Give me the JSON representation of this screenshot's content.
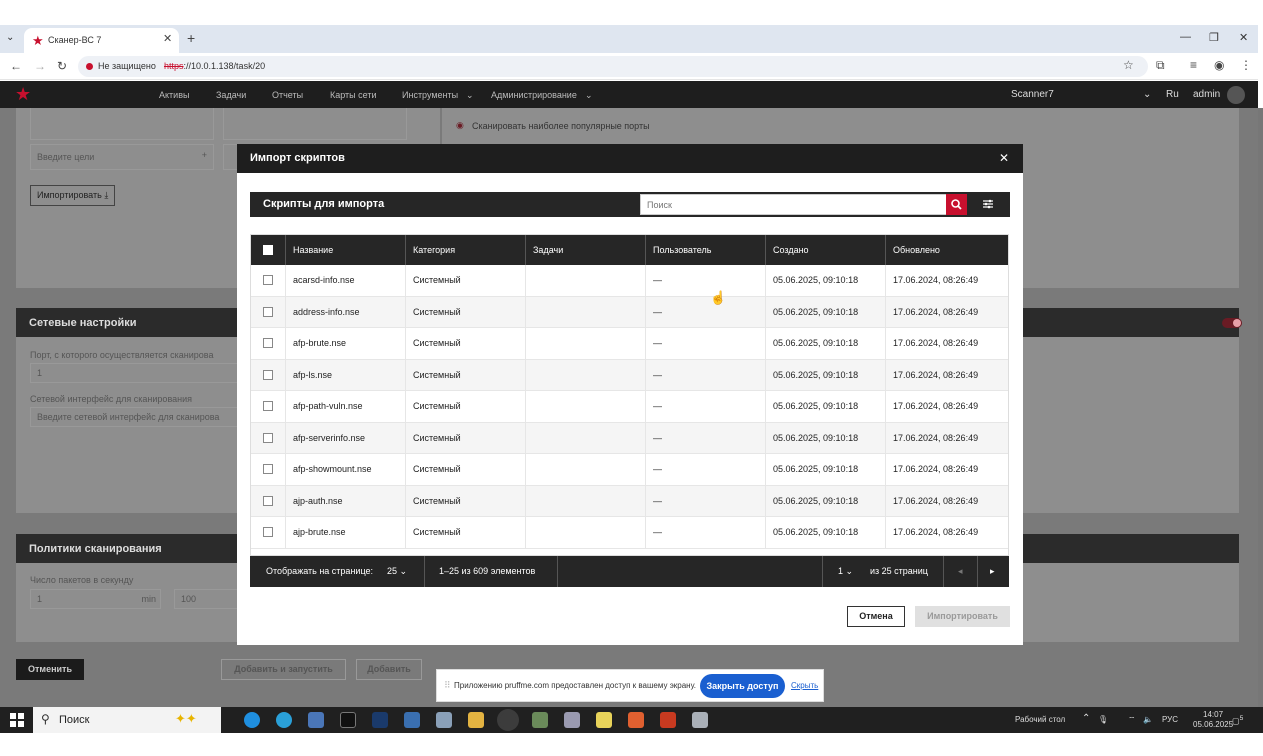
{
  "browser": {
    "tab_title": "Сканер-ВС 7",
    "security_label": "Не защищено",
    "url_scheme": "https",
    "url_rest": "://10.0.1.138/task/20"
  },
  "appnav": {
    "items": [
      "Активы",
      "Задачи",
      "Отчеты",
      "Карты сети",
      "Инструменты",
      "Администрирование"
    ],
    "scanner": "Scanner7",
    "lang": "Ru",
    "user": "admin"
  },
  "background": {
    "targets_placeholder": "Введите цели",
    "import_button": "Импортировать",
    "popular_ports": "Сканировать наиболее популярные порты",
    "net_settings_title": "Сетевые настройки",
    "port_label": "Порт, с которого осуществляется сканирова",
    "port_value": "1",
    "iface_label": "Сетевой интерфейс для сканирования",
    "iface_placeholder": "Введите сетевой интерфейс для сканирова",
    "policies_title": "Политики сканирования",
    "packets_label": "Число пакетов в секунду",
    "packets_min_value": "1",
    "packets_min_unit": "min",
    "packets_max_value": "100",
    "cancel_button": "Отменить",
    "add_run_button": "Добавить и запустить",
    "add_button": "Добавить"
  },
  "modal": {
    "title": "Импорт скриптов",
    "toolbar_title": "Скрипты для импорта",
    "search_placeholder": "Поиск",
    "columns": [
      "Название",
      "Категория",
      "Задачи",
      "Пользователь",
      "Создано",
      "Обновлено"
    ],
    "rows": [
      {
        "name": "acarsd-info.nse",
        "category": "Системный",
        "tasks": "",
        "user": "—",
        "created": "05.06.2025, 09:10:18",
        "updated": "17.06.2024, 08:26:49"
      },
      {
        "name": "address-info.nse",
        "category": "Системный",
        "tasks": "",
        "user": "—",
        "created": "05.06.2025, 09:10:18",
        "updated": "17.06.2024, 08:26:49"
      },
      {
        "name": "afp-brute.nse",
        "category": "Системный",
        "tasks": "",
        "user": "—",
        "created": "05.06.2025, 09:10:18",
        "updated": "17.06.2024, 08:26:49"
      },
      {
        "name": "afp-ls.nse",
        "category": "Системный",
        "tasks": "",
        "user": "—",
        "created": "05.06.2025, 09:10:18",
        "updated": "17.06.2024, 08:26:49"
      },
      {
        "name": "afp-path-vuln.nse",
        "category": "Системный",
        "tasks": "",
        "user": "—",
        "created": "05.06.2025, 09:10:18",
        "updated": "17.06.2024, 08:26:49"
      },
      {
        "name": "afp-serverinfo.nse",
        "category": "Системный",
        "tasks": "",
        "user": "—",
        "created": "05.06.2025, 09:10:18",
        "updated": "17.06.2024, 08:26:49"
      },
      {
        "name": "afp-showmount.nse",
        "category": "Системный",
        "tasks": "",
        "user": "—",
        "created": "05.06.2025, 09:10:18",
        "updated": "17.06.2024, 08:26:49"
      },
      {
        "name": "ajp-auth.nse",
        "category": "Системный",
        "tasks": "",
        "user": "—",
        "created": "05.06.2025, 09:10:18",
        "updated": "17.06.2024, 08:26:49"
      },
      {
        "name": "ajp-brute.nse",
        "category": "Системный",
        "tasks": "",
        "user": "—",
        "created": "05.06.2025, 09:10:18",
        "updated": "17.06.2024, 08:26:49"
      }
    ],
    "pager": {
      "per_page_label": "Отображать на странице:",
      "per_page_value": "25",
      "range": "1–25 из 609 элементов",
      "page": "1",
      "of_pages": "из 25 страниц"
    },
    "cancel_button": "Отмена",
    "import_button": "Импортировать"
  },
  "share_bar": {
    "text": "Приложению pruffme.com предоставлен доступ к вашему экрану.",
    "stop_button": "Закрыть доступ",
    "hide_link": "Скрыть"
  },
  "taskbar": {
    "search_label": "Поиск",
    "desktop_label": "Рабочий стол",
    "lang": "РУС",
    "time": "14:07",
    "date": "05.06.2025",
    "notifications": "5"
  },
  "colors": {
    "accent_red": "#c8102e",
    "dark": "#1e1e1e",
    "share_blue": "#1a5fd0"
  }
}
